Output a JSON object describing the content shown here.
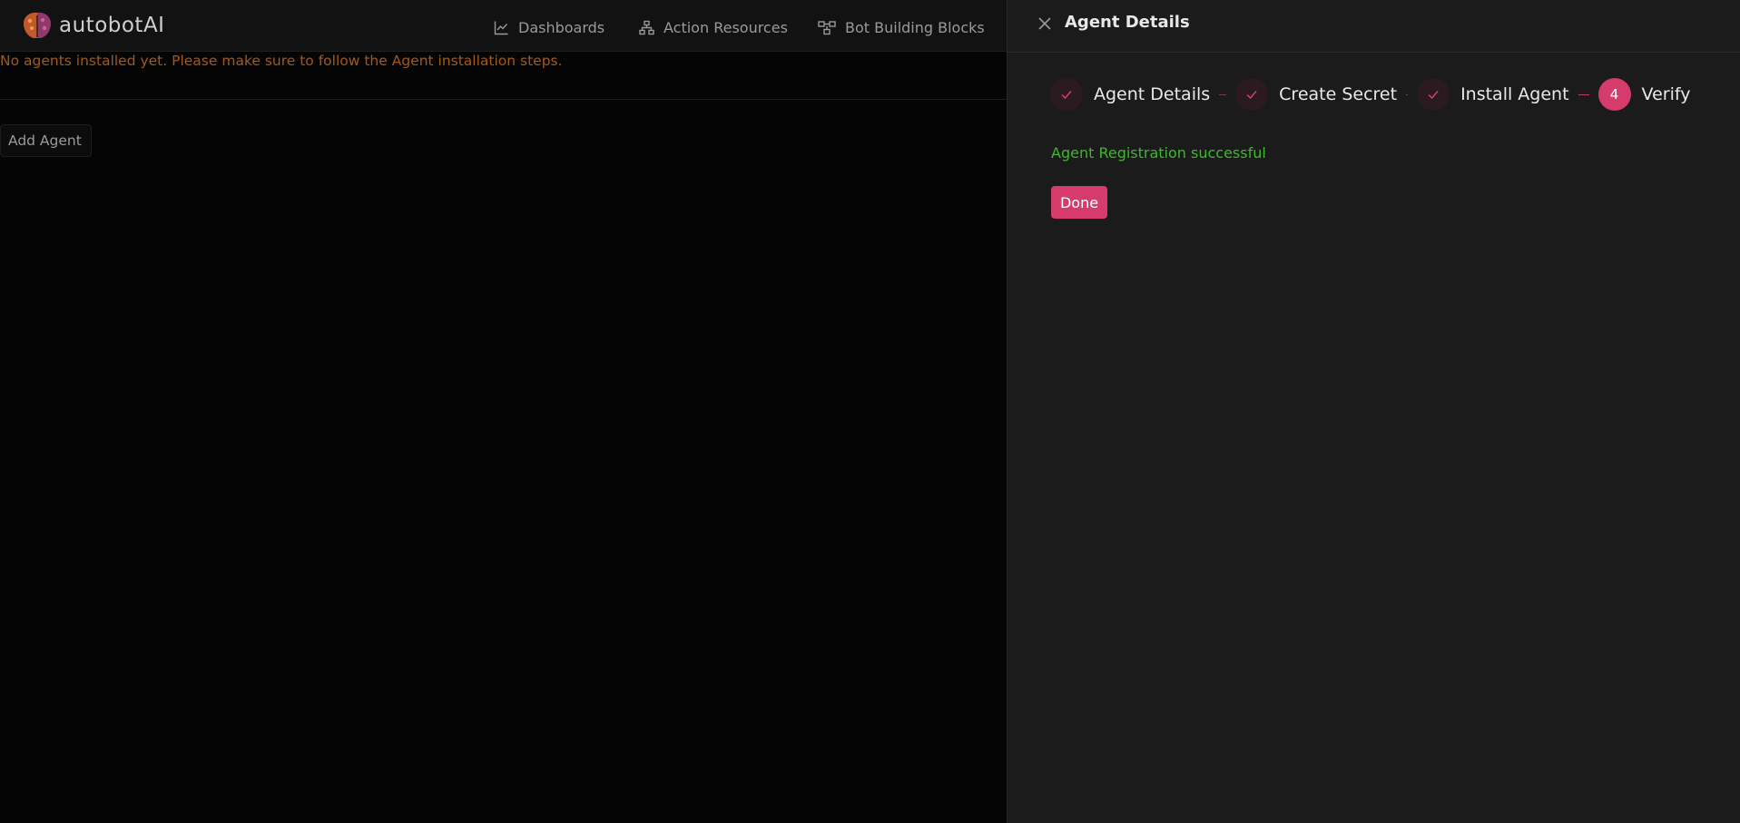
{
  "app": {
    "name": "autobotAI"
  },
  "nav": {
    "items": [
      {
        "label": "Dashboards",
        "icon": "chart-line-icon"
      },
      {
        "label": "Action Resources",
        "icon": "sitemap-icon"
      },
      {
        "label": "Bot Building Blocks",
        "icon": "blocks-icon"
      }
    ]
  },
  "main": {
    "warning": "No agents installed yet. Please make sure to follow the Agent installation steps.",
    "add_agent_label": "Add Agent"
  },
  "drawer": {
    "title": "Agent Details",
    "steps": [
      {
        "label": "Agent Details",
        "status": "done"
      },
      {
        "label": "Create Secret",
        "status": "done"
      },
      {
        "label": "Install Agent",
        "status": "done"
      },
      {
        "label": "Verify",
        "status": "active",
        "number": "4"
      }
    ],
    "success_message": "Agent Registration successful",
    "done_label": "Done"
  },
  "colors": {
    "accent": "#d63c6b",
    "success": "#3fb62e",
    "warning": "#a05a1a"
  }
}
